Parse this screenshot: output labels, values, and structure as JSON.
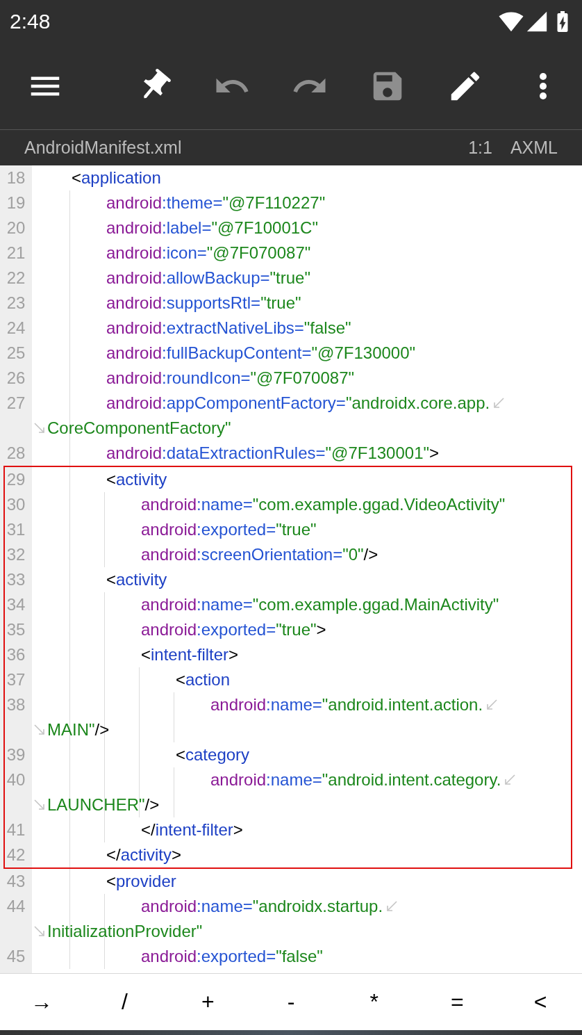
{
  "status_bar": {
    "time": "2:48"
  },
  "toolbar": {
    "buttons": [
      {
        "kind": "menu",
        "disabled": false
      },
      {
        "kind": "pin",
        "disabled": false
      },
      {
        "kind": "undo",
        "disabled": true
      },
      {
        "kind": "redo",
        "disabled": true
      },
      {
        "kind": "save",
        "disabled": true
      },
      {
        "kind": "edit",
        "disabled": false
      },
      {
        "kind": "more",
        "disabled": false
      }
    ]
  },
  "file_bar": {
    "filename": "AndroidManifest.xml",
    "position": "1:1",
    "mode": "AXML"
  },
  "code": {
    "lines": [
      {
        "number": "18",
        "highlighted": false,
        "tokens": [
          {
            "kind": "p",
            "text": "<"
          },
          {
            "kind": "tag",
            "text": "application"
          }
        ],
        "children": [
          {
            "number": "19",
            "highlighted": false,
            "tokens": [
              {
                "kind": "ns",
                "text": "android"
              },
              {
                "kind": "attr",
                "text": ":theme="
              },
              {
                "kind": "val",
                "text": "\"@7F110227\""
              }
            ]
          },
          {
            "number": "20",
            "highlighted": false,
            "tokens": [
              {
                "kind": "ns",
                "text": "android"
              },
              {
                "kind": "attr",
                "text": ":label="
              },
              {
                "kind": "val",
                "text": "\"@7F10001C\""
              }
            ]
          },
          {
            "number": "21",
            "highlighted": false,
            "tokens": [
              {
                "kind": "ns",
                "text": "android"
              },
              {
                "kind": "attr",
                "text": ":icon="
              },
              {
                "kind": "val",
                "text": "\"@7F070087\""
              }
            ]
          },
          {
            "number": "22",
            "highlighted": false,
            "tokens": [
              {
                "kind": "ns",
                "text": "android"
              },
              {
                "kind": "attr",
                "text": ":allowBackup="
              },
              {
                "kind": "val",
                "text": "\"true\""
              }
            ]
          },
          {
            "number": "23",
            "highlighted": false,
            "tokens": [
              {
                "kind": "ns",
                "text": "android"
              },
              {
                "kind": "attr",
                "text": ":supportsRtl="
              },
              {
                "kind": "val",
                "text": "\"true\""
              }
            ]
          },
          {
            "number": "24",
            "highlighted": false,
            "tokens": [
              {
                "kind": "ns",
                "text": "android"
              },
              {
                "kind": "attr",
                "text": ":extractNativeLibs="
              },
              {
                "kind": "val",
                "text": "\"false\""
              }
            ]
          },
          {
            "number": "25",
            "highlighted": false,
            "tokens": [
              {
                "kind": "ns",
                "text": "android"
              },
              {
                "kind": "attr",
                "text": ":fullBackupContent="
              },
              {
                "kind": "val",
                "text": "\"@7F130000\""
              }
            ]
          },
          {
            "number": "26",
            "highlighted": false,
            "tokens": [
              {
                "kind": "ns",
                "text": "android"
              },
              {
                "kind": "attr",
                "text": ":roundIcon="
              },
              {
                "kind": "val",
                "text": "\"@7F070087\""
              }
            ]
          },
          {
            "number": "27",
            "highlighted": false,
            "tokens": [
              {
                "kind": "ns",
                "text": "android"
              },
              {
                "kind": "attr",
                "text": ":appComponentFactory="
              },
              {
                "kind": "val",
                "text": "\"androidx.core.app."
              }
            ],
            "continuation": [
              {
                "kind": "val",
                "text": "CoreComponentFactory\""
              }
            ]
          },
          {
            "number": "28",
            "highlighted": false,
            "tokens": [
              {
                "kind": "ns",
                "text": "android"
              },
              {
                "kind": "attr",
                "text": ":dataExtractionRules="
              },
              {
                "kind": "val",
                "text": "\"@7F130001\""
              },
              {
                "kind": "p",
                "text": ">"
              }
            ]
          },
          {
            "number": "29",
            "highlighted": true,
            "tokens": [
              {
                "kind": "p",
                "text": "<"
              },
              {
                "kind": "tag",
                "text": "activity"
              }
            ],
            "children": [
              {
                "number": "30",
                "highlighted": true,
                "tokens": [
                  {
                    "kind": "ns",
                    "text": "android"
                  },
                  {
                    "kind": "attr",
                    "text": ":name="
                  },
                  {
                    "kind": "val",
                    "text": "\"com.example.ggad.VideoActivity\""
                  }
                ]
              },
              {
                "number": "31",
                "highlighted": true,
                "tokens": [
                  {
                    "kind": "ns",
                    "text": "android"
                  },
                  {
                    "kind": "attr",
                    "text": ":exported="
                  },
                  {
                    "kind": "val",
                    "text": "\"true\""
                  }
                ]
              },
              {
                "number": "32",
                "highlighted": true,
                "tokens": [
                  {
                    "kind": "ns",
                    "text": "android"
                  },
                  {
                    "kind": "attr",
                    "text": ":screenOrientation="
                  },
                  {
                    "kind": "val",
                    "text": "\"0\""
                  },
                  {
                    "kind": "p",
                    "text": "/>"
                  }
                ]
              }
            ]
          },
          {
            "number": "33",
            "highlighted": true,
            "tokens": [
              {
                "kind": "p",
                "text": "<"
              },
              {
                "kind": "tag",
                "text": "activity"
              }
            ],
            "children": [
              {
                "number": "34",
                "highlighted": true,
                "tokens": [
                  {
                    "kind": "ns",
                    "text": "android"
                  },
                  {
                    "kind": "attr",
                    "text": ":name="
                  },
                  {
                    "kind": "val",
                    "text": "\"com.example.ggad.MainActivity\""
                  }
                ]
              },
              {
                "number": "35",
                "highlighted": true,
                "tokens": [
                  {
                    "kind": "ns",
                    "text": "android"
                  },
                  {
                    "kind": "attr",
                    "text": ":exported="
                  },
                  {
                    "kind": "val",
                    "text": "\"true\""
                  },
                  {
                    "kind": "p",
                    "text": ">"
                  }
                ]
              },
              {
                "number": "36",
                "highlighted": true,
                "tokens": [
                  {
                    "kind": "p",
                    "text": "<"
                  },
                  {
                    "kind": "tag",
                    "text": "intent-filter"
                  },
                  {
                    "kind": "p",
                    "text": ">"
                  }
                ],
                "children": [
                  {
                    "number": "37",
                    "highlighted": true,
                    "tokens": [
                      {
                        "kind": "p",
                        "text": "<"
                      },
                      {
                        "kind": "tag",
                        "text": "action"
                      }
                    ],
                    "children": [
                      {
                        "number": "38",
                        "highlighted": true,
                        "tokens": [
                          {
                            "kind": "ns",
                            "text": "android"
                          },
                          {
                            "kind": "attr",
                            "text": ":name="
                          },
                          {
                            "kind": "val",
                            "text": "\"android.intent.action."
                          }
                        ],
                        "continuation": [
                          {
                            "kind": "val",
                            "text": "MAIN\""
                          },
                          {
                            "kind": "p",
                            "text": "/>"
                          }
                        ]
                      }
                    ]
                  },
                  {
                    "number": "39",
                    "highlighted": true,
                    "tokens": [
                      {
                        "kind": "p",
                        "text": "<"
                      },
                      {
                        "kind": "tag",
                        "text": "category"
                      }
                    ],
                    "children": [
                      {
                        "number": "40",
                        "highlighted": true,
                        "tokens": [
                          {
                            "kind": "ns",
                            "text": "android"
                          },
                          {
                            "kind": "attr",
                            "text": ":name="
                          },
                          {
                            "kind": "val",
                            "text": "\"android.intent.category."
                          }
                        ],
                        "continuation": [
                          {
                            "kind": "val",
                            "text": "LAUNCHER\""
                          },
                          {
                            "kind": "p",
                            "text": "/>"
                          }
                        ]
                      }
                    ]
                  }
                ]
              },
              {
                "number": "41",
                "highlighted": true,
                "tokens": [
                  {
                    "kind": "p",
                    "text": "</"
                  },
                  {
                    "kind": "tag",
                    "text": "intent-filter"
                  },
                  {
                    "kind": "p",
                    "text": ">"
                  }
                ]
              }
            ]
          },
          {
            "number": "42",
            "highlighted": true,
            "tokens": [
              {
                "kind": "p",
                "text": "</"
              },
              {
                "kind": "tag",
                "text": "activity"
              },
              {
                "kind": "p",
                "text": ">"
              }
            ]
          },
          {
            "number": "43",
            "highlighted": false,
            "tokens": [
              {
                "kind": "p",
                "text": "<"
              },
              {
                "kind": "tag",
                "text": "provider"
              }
            ],
            "children": [
              {
                "number": "44",
                "highlighted": false,
                "tokens": [
                  {
                    "kind": "ns",
                    "text": "android"
                  },
                  {
                    "kind": "attr",
                    "text": ":name="
                  },
                  {
                    "kind": "val",
                    "text": "\"androidx.startup."
                  }
                ],
                "continuation": [
                  {
                    "kind": "val",
                    "text": "InitializationProvider\""
                  }
                ]
              },
              {
                "number": "45",
                "highlighted": false,
                "tokens": [
                  {
                    "kind": "ns",
                    "text": "android"
                  },
                  {
                    "kind": "attr",
                    "text": ":exported="
                  },
                  {
                    "kind": "val",
                    "text": "\"false\""
                  }
                ]
              }
            ]
          }
        ]
      }
    ]
  },
  "symbol_bar": {
    "keys": [
      "→",
      "/",
      "+",
      "-",
      "*",
      "=",
      "<"
    ]
  }
}
